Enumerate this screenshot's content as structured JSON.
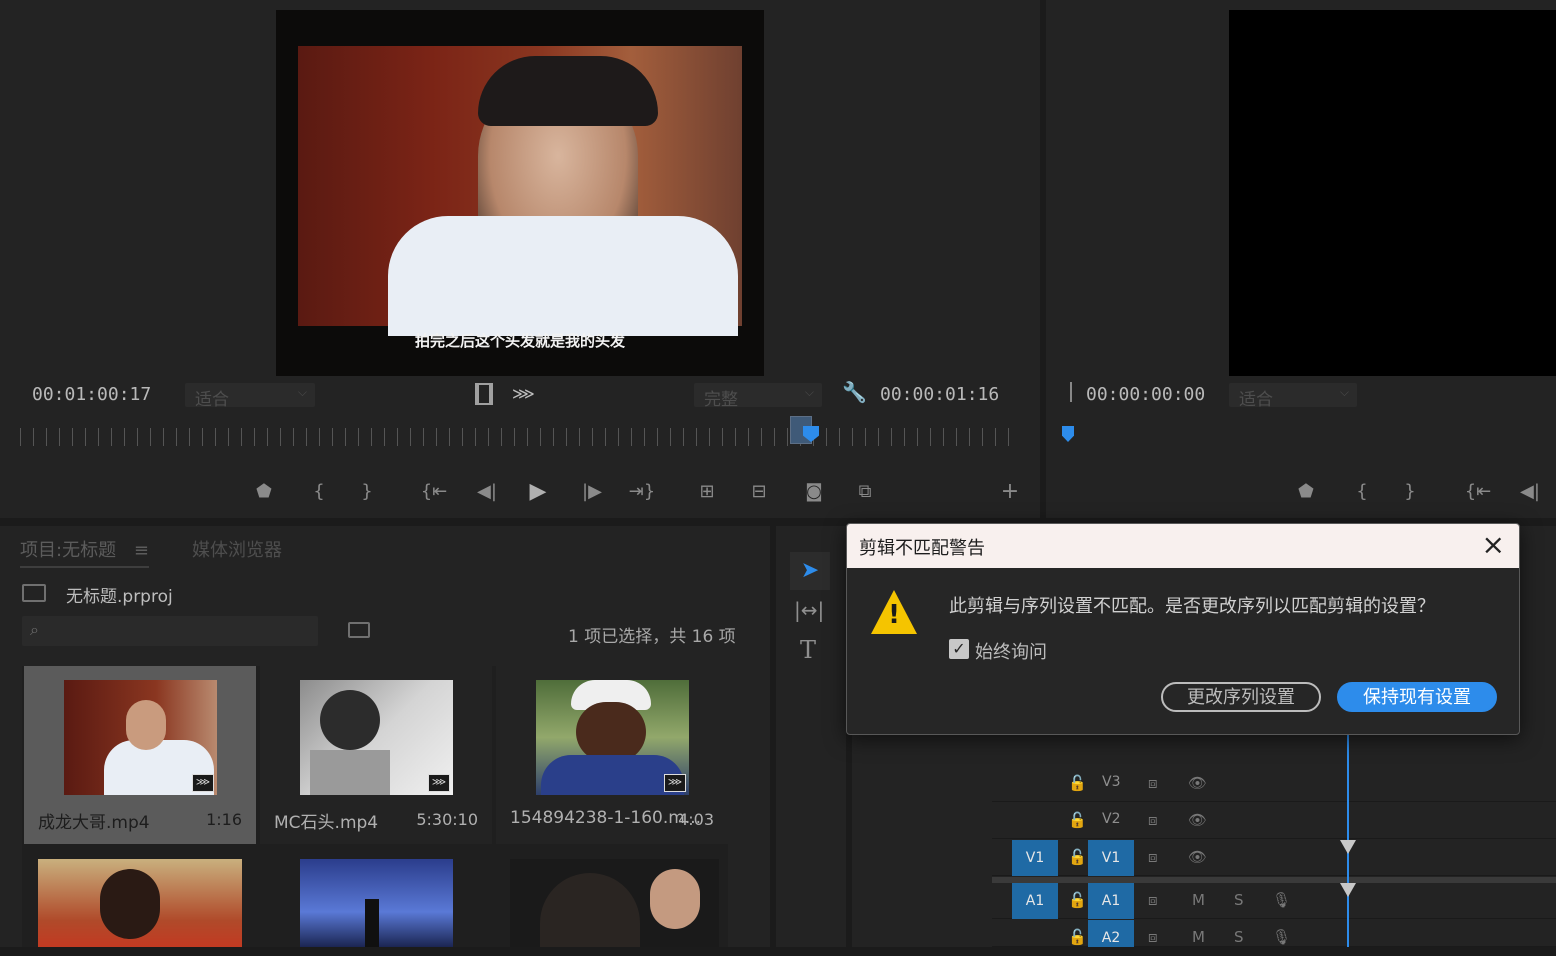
{
  "source_monitor": {
    "timecode_left": "00:01:00:17",
    "fit_label": "适合",
    "quality_label": "完整",
    "timecode_right": "00:00:01:16",
    "subtitle": "拍完之后这个头发就是我的头发"
  },
  "program_monitor": {
    "timecode": "00:00:00:00",
    "fit_label": "适合"
  },
  "project_panel": {
    "tab_project": "项目:无标题",
    "tab_media_browser": "媒体浏览器",
    "project_file": "无标题.prproj",
    "search_placeholder": "",
    "selection_status": "1 项已选择，共 16 项",
    "items": [
      {
        "name": "成龙大哥.mp4",
        "duration": "1:16"
      },
      {
        "name": "MC石头.mp4",
        "duration": "5:30:10"
      },
      {
        "name": "154894238-1-160.m...",
        "duration": "4:03"
      }
    ]
  },
  "timeline": {
    "tracks": [
      {
        "source": "",
        "name": "V3",
        "mute": "",
        "solo": ""
      },
      {
        "source": "",
        "name": "V2",
        "mute": "",
        "solo": ""
      },
      {
        "source": "V1",
        "name": "V1",
        "mute": "",
        "solo": ""
      },
      {
        "source": "A1",
        "name": "A1",
        "mute": "M",
        "solo": "S"
      },
      {
        "source": "",
        "name": "A2",
        "mute": "M",
        "solo": "S"
      }
    ]
  },
  "dialog": {
    "title": "剪辑不匹配警告",
    "message": "此剪辑与序列设置不匹配。是否更改序列以匹配剪辑的设置？",
    "checkbox_label": "始终询问",
    "checkbox_checked": true,
    "change_button": "更改序列设置",
    "keep_button": "保持现有设置"
  },
  "colors": {
    "accent": "#2d8ceb",
    "track_blue": "#1f6aa5",
    "warning": "#f5c400"
  }
}
